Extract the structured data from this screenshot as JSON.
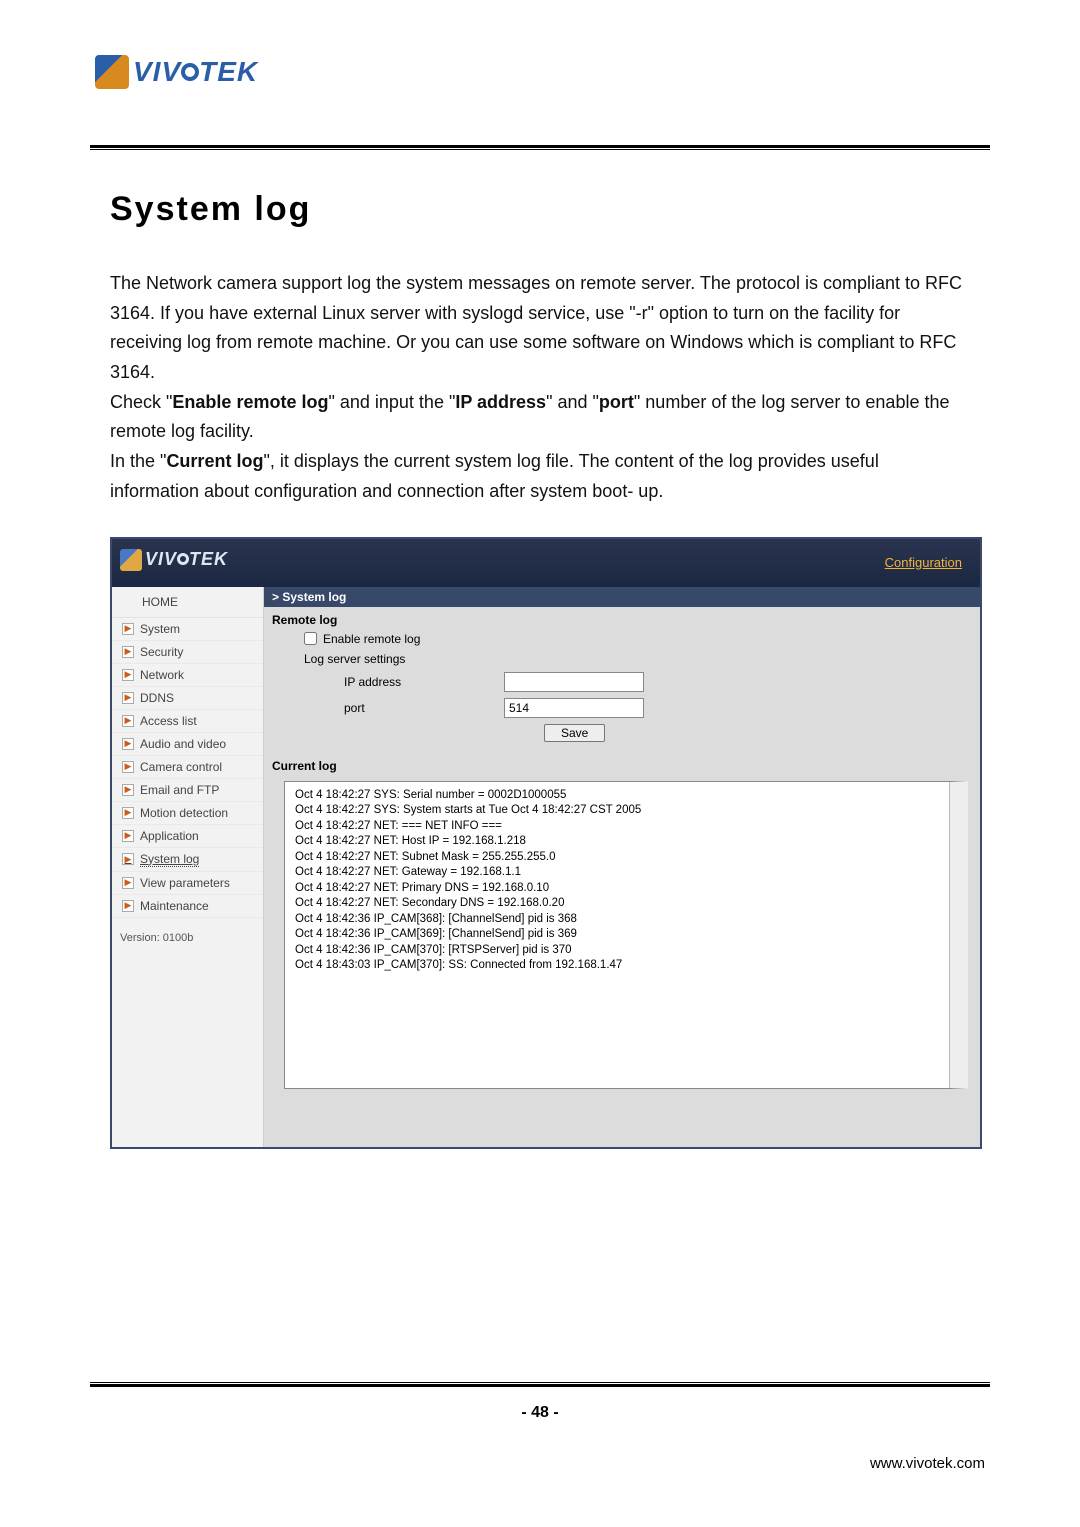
{
  "logo_text": "VIVOTEK",
  "heading": "System log",
  "paragraph1": "The Network camera support log the system messages on remote server. The protocol is compliant to RFC 3164. If you have external Linux server with syslogd service, use \"-r\" option to turn on the facility for receiving log from remote machine. Or you can use some software on Windows which is compliant to RFC 3164.",
  "paragraph2a": "Check \"",
  "paragraph2_bold1": "Enable remote log",
  "paragraph2b": "\" and input the \"",
  "paragraph2_bold2": "IP address",
  "paragraph2c": "\" and \"",
  "paragraph2_bold3": "port",
  "paragraph2d": "\" number of the log server to enable the remote log facility.",
  "paragraph3a": "In the \"",
  "paragraph3_bold1": "Current log",
  "paragraph3b": "\", it displays the current system log file. The content of the log provides useful information about configuration and connection after system boot- up.",
  "shot": {
    "configuration_link": "Configuration",
    "sidebar": {
      "home": "HOME",
      "items": [
        "System",
        "Security",
        "Network",
        "DDNS",
        "Access list",
        "Audio and video",
        "Camera control",
        "Email and FTP",
        "Motion detection",
        "Application",
        "System log",
        "View parameters",
        "Maintenance"
      ],
      "version": "Version: 0100b"
    },
    "main": {
      "section_title": "> System log",
      "remote_log_heading": "Remote log",
      "enable_remote_label": "Enable remote log",
      "log_server_settings_label": "Log server settings",
      "ip_address_label": "IP address",
      "ip_address_value": "",
      "port_label": "port",
      "port_value": "514",
      "save_label": "Save",
      "current_log_heading": "Current log",
      "log_lines": [
        "Oct 4 18:42:27 SYS: Serial number = 0002D1000055",
        "Oct 4 18:42:27 SYS: System starts at Tue Oct 4 18:42:27 CST 2005",
        "Oct 4 18:42:27 NET: === NET INFO ===",
        "Oct 4 18:42:27 NET: Host IP = 192.168.1.218",
        "Oct 4 18:42:27 NET: Subnet Mask = 255.255.255.0",
        "Oct 4 18:42:27 NET: Gateway = 192.168.1.1",
        "Oct 4 18:42:27 NET: Primary DNS = 192.168.0.10",
        "Oct 4 18:42:27 NET: Secondary DNS = 192.168.0.20",
        "Oct 4 18:42:36 IP_CAM[368]: [ChannelSend] pid is 368",
        "Oct 4 18:42:36 IP_CAM[369]: [ChannelSend] pid is 369",
        "Oct 4 18:42:36 IP_CAM[370]: [RTSPServer] pid is 370",
        "Oct 4 18:43:03 IP_CAM[370]: SS: Connected from 192.168.1.47"
      ]
    }
  },
  "page_number": "- 48 -",
  "footer_url": "www.vivotek.com"
}
